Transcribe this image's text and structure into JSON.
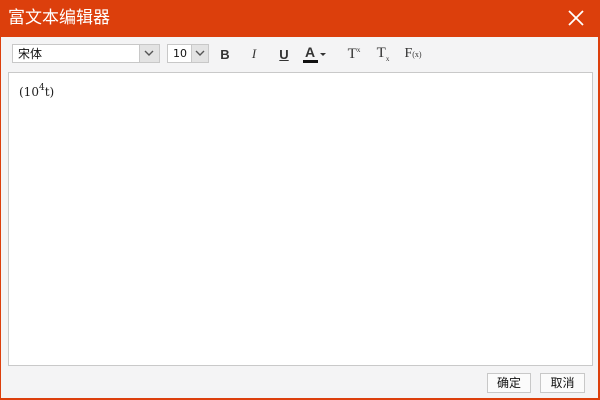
{
  "dialog": {
    "title": "富文本编辑器"
  },
  "toolbar": {
    "font_family": "宋体",
    "font_size": "10",
    "bold_label": "B",
    "italic_label": "I",
    "underline_label": "U",
    "font_color_label": "A",
    "font_color": "#111111",
    "superscript_label": "T",
    "subscript_label": "T",
    "formula_label": "F"
  },
  "editor": {
    "text_before": "(10",
    "superscript": "4",
    "text_after": "t)"
  },
  "footer": {
    "ok_label": "确定",
    "cancel_label": "取消"
  },
  "colors": {
    "accent": "#dc3f0c",
    "panel": "#f4f4f5"
  }
}
